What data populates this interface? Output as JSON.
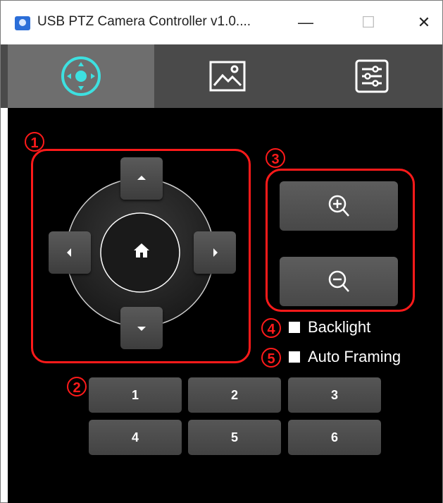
{
  "window": {
    "title": "USB PTZ Camera Controller v1.0....",
    "minimize_glyph": "—",
    "maximize_glyph": "☐",
    "close_glyph": "✕"
  },
  "tabs": [
    {
      "name": "tab-ptz-control",
      "icon": "joystick-icon",
      "active": true
    },
    {
      "name": "tab-image",
      "icon": "image-icon",
      "active": false
    },
    {
      "name": "tab-settings",
      "icon": "sliders-icon",
      "active": false
    }
  ],
  "annotations": {
    "a1": "1",
    "a2": "2",
    "a3": "3",
    "a4": "4",
    "a5": "5"
  },
  "options": {
    "backlight_label": "Backlight",
    "auto_framing_label": "Auto Framing",
    "backlight_checked": false,
    "auto_framing_checked": false
  },
  "presets": {
    "p1": "1",
    "p2": "2",
    "p3": "3",
    "p4": "4",
    "p5": "5",
    "p6": "6"
  },
  "colors": {
    "accent": "#3de0e0",
    "annotation": "#ff1a1a",
    "background": "#000000",
    "tab_active": "#6e6e6e",
    "tab_bar": "#4a4a4a"
  }
}
